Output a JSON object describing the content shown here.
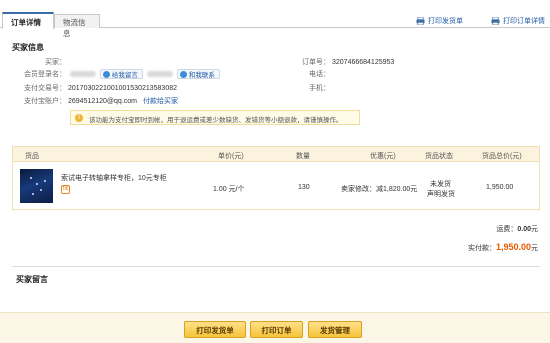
{
  "tabs": [
    {
      "label": "订单详情",
      "active": true
    },
    {
      "label": "物流信息",
      "active": false
    }
  ],
  "top_links": {
    "print_shipping": "打印发货单",
    "print_order": "打印订单详情"
  },
  "buyer_section": {
    "title": "买家信息",
    "buyer_label": "买家：",
    "member_label": "会员登录名：",
    "chip_message": "给我留言",
    "chip_contact": "和我联系",
    "trade_no_label": "支付交易号：",
    "trade_no": "2017030221001001530213583082",
    "alipay_label": "支付宝账户：",
    "alipay_account": "2694512120@qq.com",
    "pay_buyer_link": "付款给买家",
    "order_no_label": "订单号：",
    "order_no": "3207466684125953",
    "phone_label": "电话：",
    "mobile_label": "手机："
  },
  "notice": "该功能为支付宝即时到帐，用于退运费或差少数缺货、发错货等小额退款，请谨慎操作。",
  "table": {
    "headers": [
      "货品",
      "单价(元)",
      "数量",
      "优惠(元)",
      "货品状态",
      "货品总价(元)"
    ],
    "row": {
      "goods": "索试电子转轴拿样专柜，10元专柜",
      "unit_price": "1.00 元/个",
      "quantity": "130",
      "discount": "卖家修改：减1,820.00元",
      "status": "未发货",
      "status_link": "声明发货",
      "total": "1,950.00"
    }
  },
  "summary": {
    "shipping_label": "运费：",
    "shipping_value": "0.00",
    "shipping_unit": "元",
    "paid_label": "实付款：",
    "paid_value": "1,950.00",
    "paid_unit": "元"
  },
  "buyer_message_title": "买家留言",
  "footer_buttons": [
    "打印发货单",
    "打印订单",
    "发货管理"
  ],
  "colors": {
    "accent_link": "#1f5aa6",
    "total_orange": "#e65a00",
    "button_yellow": "#f6c33a"
  }
}
